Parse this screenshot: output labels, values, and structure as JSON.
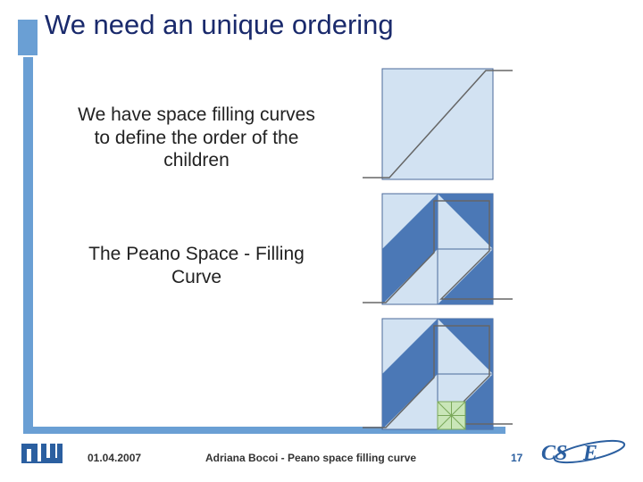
{
  "title": "We need an unique ordering",
  "body": {
    "para1": "We have space filling curves to define the order of the children",
    "para2": "The Peano Space - Filling Curve"
  },
  "footer": {
    "date": "01.04.2007",
    "author": "Adriana Bocoi - Peano space filling curve",
    "page": "17"
  },
  "logos": {
    "left": "TUM",
    "right": "CSE"
  },
  "colors": {
    "accent": "#6a9fd4",
    "title": "#1a2a6c",
    "pagenum": "#2b5fa0"
  }
}
